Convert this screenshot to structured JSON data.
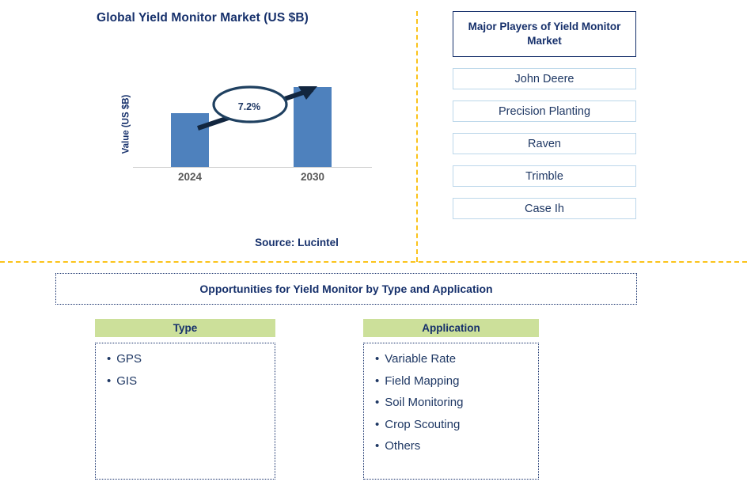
{
  "chart": {
    "title": "Global Yield Monitor Market (US $B)",
    "y_axis_label": "Value (US $B)",
    "cagr_label": "7.2%",
    "source": "Source: Lucintel"
  },
  "chart_data": {
    "type": "bar",
    "title": "Global Yield Monitor Market (US $B)",
    "categories": [
      "2024",
      "2030"
    ],
    "values": [
      1.0,
      1.48
    ],
    "xlabel": "",
    "ylabel": "Value (US $B)",
    "ylim": [
      0,
      1.7
    ],
    "grid": false,
    "legend": "none",
    "bar_color": "#4e81bd",
    "annotations": [
      {
        "text": "7.2%",
        "type": "cagr-callout",
        "from": "2024",
        "to": "2030"
      }
    ],
    "source": "Source: Lucintel"
  },
  "players": {
    "header": "Major Players of Yield Monitor Market",
    "items": [
      {
        "label": "John Deere"
      },
      {
        "label": "Precision Planting"
      },
      {
        "label": "Raven"
      },
      {
        "label": "Trimble"
      },
      {
        "label": "Case Ih"
      }
    ]
  },
  "opportunities": {
    "banner": "Opportunities for Yield Monitor by Type and Application",
    "columns": [
      {
        "header": "Type",
        "items": [
          "GPS",
          "GIS"
        ]
      },
      {
        "header": "Application",
        "items": [
          "Variable Rate",
          "Field Mapping",
          "Soil Monitoring",
          "Crop Scouting",
          "Others"
        ]
      }
    ]
  },
  "colors": {
    "navy": "#16306b",
    "bar_blue": "#4e81bd",
    "divider_gold": "#fbc31b",
    "header_green": "#cce09a",
    "player_border": "#bcd7ea"
  }
}
